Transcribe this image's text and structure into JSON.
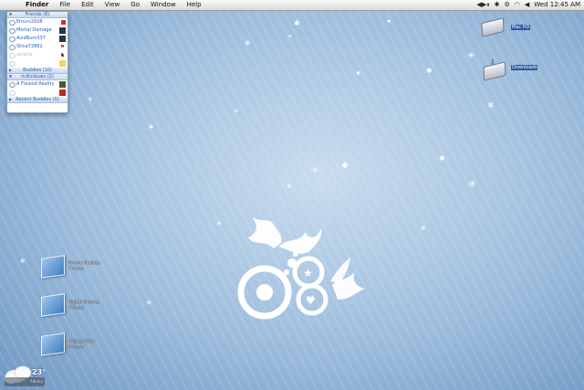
{
  "menubar": {
    "apple_icon": "apple-menu-icon",
    "items": [
      "Finder",
      "File",
      "Edit",
      "View",
      "Go",
      "Window",
      "Help"
    ],
    "clock": "Wed 12:45 AM",
    "status_icons": [
      "media-controls-icon",
      "bluetooth-icon",
      "gear-icon",
      "wifi-icon",
      "volume-icon"
    ]
  },
  "buddy_list": {
    "groups": [
      {
        "name": "Friends (6)",
        "buddies": [
          {
            "name": "Emurs2928",
            "idle": false
          },
          {
            "name": "Mortal Damage",
            "idle": false
          },
          {
            "name": "AcidBurn337",
            "idle": false
          },
          {
            "name": "Stina72882",
            "idle": false
          },
          {
            "name": "ahlatta",
            "idle": true
          },
          {
            "name": "",
            "idle": true
          }
        ]
      },
      {
        "name": "Buddies (10)",
        "buddies": []
      },
      {
        "name": "Individuals (2)",
        "buddies": [
          {
            "name": "A Flaxoid Reality",
            "idle": false
          },
          {
            "name": "",
            "idle": true
          }
        ]
      },
      {
        "name": "Recent Buddies (0)",
        "buddies": []
      }
    ]
  },
  "desktop": {
    "drives": [
      {
        "title": "Mac HD",
        "subtitle": "",
        "icon": "hard-drive-icon"
      },
      {
        "title": "Downloads",
        "subtitle": "",
        "icon": "downloads-drive-icon"
      }
    ],
    "folders": [
      {
        "line1": "Theme Projects",
        "line2": "7 items"
      },
      {
        "line1": "Digital Pictures",
        "line2": "4 items"
      },
      {
        "line1": "A Class Work",
        "line2": "6 items"
      }
    ]
  },
  "weather": {
    "temp": "23°",
    "city": "Albany",
    "icon": "cloud-icon"
  },
  "wallpaper": {
    "base_color": "#9ebedd",
    "accent_color": "#ffffff"
  }
}
